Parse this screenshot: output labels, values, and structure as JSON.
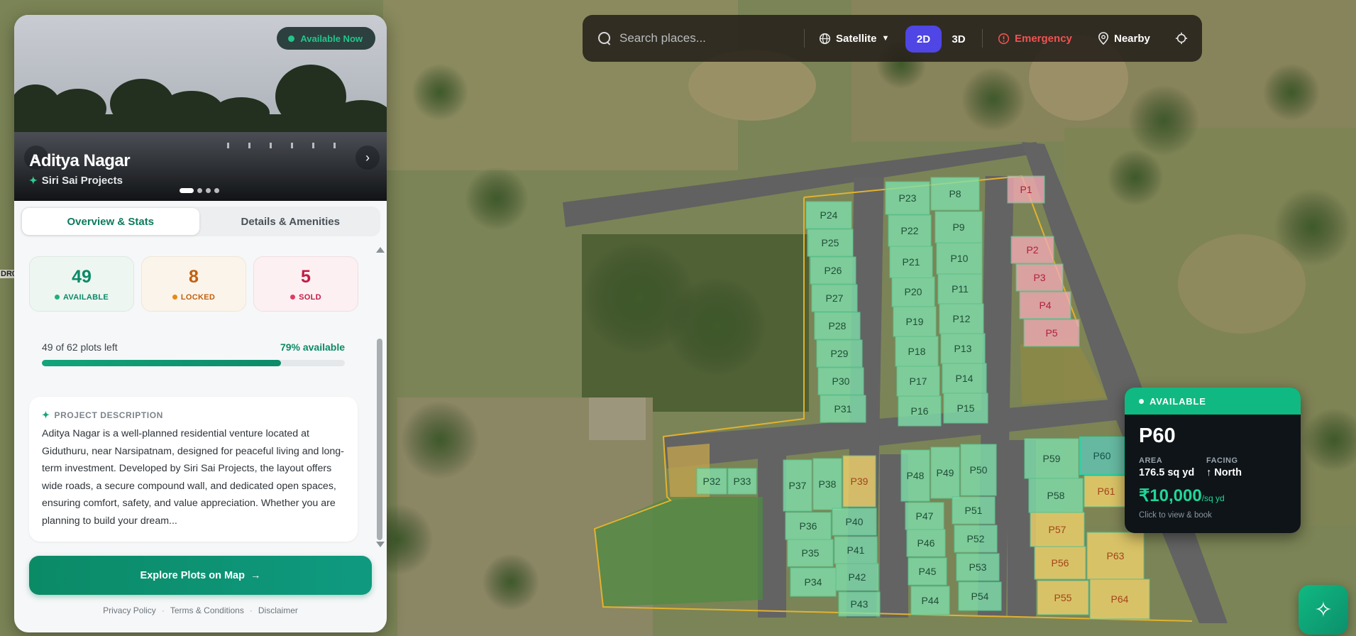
{
  "colors": {
    "accent_green": "#10b981",
    "brand_indigo": "#4f46e5",
    "emergency_red": "#ef4444",
    "plot_available": "#86dfb0",
    "plot_locked": "#f1d36b",
    "plot_sold": "#f2a8b3"
  },
  "project": {
    "status_badge": "Available Now",
    "title": "Aditya Nagar",
    "developer": "Siri Sai Projects",
    "slide_count": 4,
    "active_slide": 1
  },
  "tabs": [
    {
      "label": "Overview & Stats",
      "active": true
    },
    {
      "label": "Details & Amenities",
      "active": false
    }
  ],
  "stats": {
    "available_count": "49",
    "available_label": "AVAILABLE",
    "locked_count": "8",
    "locked_label": "LOCKED",
    "sold_count": "5",
    "sold_label": "SOLD"
  },
  "progress": {
    "left_text": "49 of 62 plots left",
    "right_text": "79% available",
    "fraction": 0.79
  },
  "description": {
    "heading": "PROJECT DESCRIPTION",
    "text": "Aditya Nagar is a well-planned residential venture located at Giduthuru, near Narsipatnam, designed for peaceful living and long-term investment. Developed by Siri Sai Projects, the layout offers wide roads, a secure compound wall, and dedicated open spaces, ensuring comfort, safety, and value appreciation. Whether you are planning to build your dream..."
  },
  "cta": {
    "explore_label": "Explore Plots on Map"
  },
  "footer": {
    "privacy": "Privacy Policy",
    "terms": "Terms & Conditions",
    "disclaimer": "Disclaimer"
  },
  "toolbar": {
    "search_placeholder": "Search places...",
    "map_style": "Satellite",
    "mode_2d": "2D",
    "mode_3d": "3D",
    "emergency": "Emergency",
    "nearby": "Nearby"
  },
  "selected_plot": {
    "status": "AVAILABLE",
    "id": "P60",
    "area_label": "AREA",
    "area_value": "176.5 sq yd",
    "facing_label": "FACING",
    "facing_value": "North",
    "price": "₹10,000",
    "price_unit": "/sq yd",
    "hint": "Click to view & book"
  },
  "map": {
    "edge_label": "DR0",
    "plots": [
      {
        "id": "P1",
        "status": "sold"
      },
      {
        "id": "P2",
        "status": "sold"
      },
      {
        "id": "P3",
        "status": "sold"
      },
      {
        "id": "P4",
        "status": "sold"
      },
      {
        "id": "P5",
        "status": "sold"
      },
      {
        "id": "P8",
        "status": "available"
      },
      {
        "id": "P9",
        "status": "available"
      },
      {
        "id": "P10",
        "status": "available"
      },
      {
        "id": "P11",
        "status": "available"
      },
      {
        "id": "P12",
        "status": "available"
      },
      {
        "id": "P13",
        "status": "available"
      },
      {
        "id": "P14",
        "status": "available"
      },
      {
        "id": "P15",
        "status": "available"
      },
      {
        "id": "P16",
        "status": "available"
      },
      {
        "id": "P17",
        "status": "available"
      },
      {
        "id": "P18",
        "status": "available"
      },
      {
        "id": "P19",
        "status": "available"
      },
      {
        "id": "P20",
        "status": "available"
      },
      {
        "id": "P21",
        "status": "available"
      },
      {
        "id": "P22",
        "status": "available"
      },
      {
        "id": "P23",
        "status": "available"
      },
      {
        "id": "P24",
        "status": "available"
      },
      {
        "id": "P25",
        "status": "available"
      },
      {
        "id": "P26",
        "status": "available"
      },
      {
        "id": "P27",
        "status": "available"
      },
      {
        "id": "P28",
        "status": "available"
      },
      {
        "id": "P29",
        "status": "available"
      },
      {
        "id": "P30",
        "status": "available"
      },
      {
        "id": "P31",
        "status": "available"
      },
      {
        "id": "P32",
        "status": "available"
      },
      {
        "id": "P33",
        "status": "available"
      },
      {
        "id": "P34",
        "status": "available"
      },
      {
        "id": "P35",
        "status": "available"
      },
      {
        "id": "P36",
        "status": "available"
      },
      {
        "id": "P37",
        "status": "available"
      },
      {
        "id": "P38",
        "status": "available"
      },
      {
        "id": "P39",
        "status": "locked"
      },
      {
        "id": "P40",
        "status": "available"
      },
      {
        "id": "P41",
        "status": "available"
      },
      {
        "id": "P42",
        "status": "available"
      },
      {
        "id": "P43",
        "status": "available"
      },
      {
        "id": "P44",
        "status": "available"
      },
      {
        "id": "P45",
        "status": "available"
      },
      {
        "id": "P46",
        "status": "available"
      },
      {
        "id": "P47",
        "status": "available"
      },
      {
        "id": "P48",
        "status": "available"
      },
      {
        "id": "P49",
        "status": "available"
      },
      {
        "id": "P50",
        "status": "available"
      },
      {
        "id": "P51",
        "status": "available"
      },
      {
        "id": "P52",
        "status": "available"
      },
      {
        "id": "P53",
        "status": "available"
      },
      {
        "id": "P54",
        "status": "available"
      },
      {
        "id": "P55",
        "status": "locked"
      },
      {
        "id": "P56",
        "status": "locked"
      },
      {
        "id": "P57",
        "status": "locked"
      },
      {
        "id": "P58",
        "status": "available"
      },
      {
        "id": "P59",
        "status": "available"
      },
      {
        "id": "P60",
        "status": "selected"
      },
      {
        "id": "P61",
        "status": "locked"
      },
      {
        "id": "P63",
        "status": "locked"
      },
      {
        "id": "P64",
        "status": "locked"
      }
    ]
  }
}
